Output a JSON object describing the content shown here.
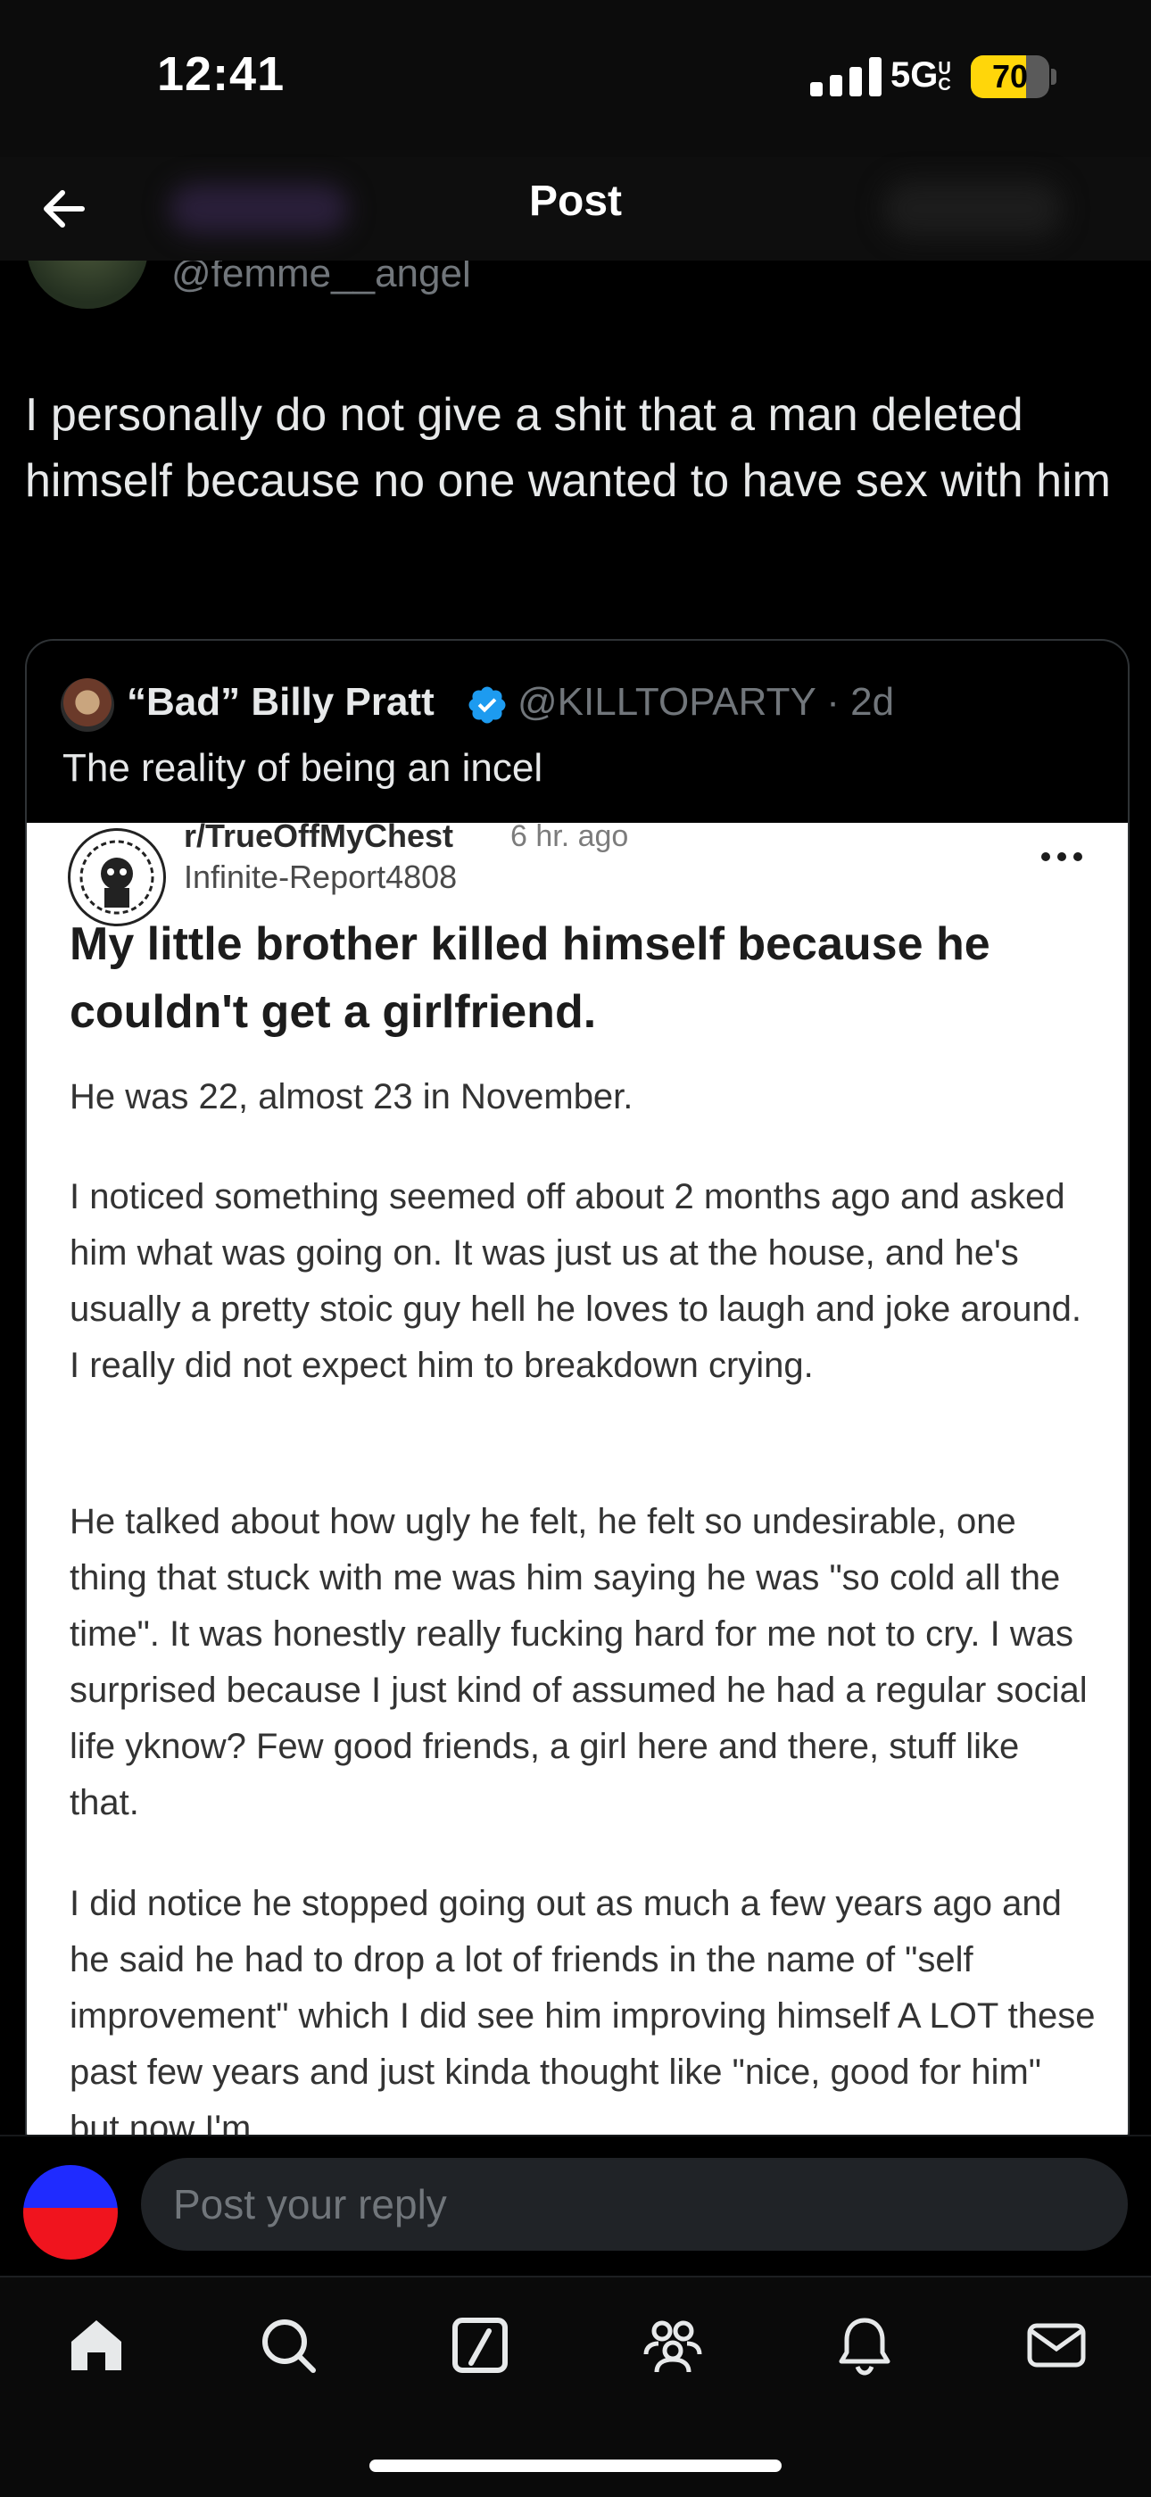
{
  "status_bar": {
    "time": "12:41",
    "network": "5G",
    "network_sup": "UC",
    "battery_percent": 70,
    "battery_label": "70"
  },
  "header": {
    "title": "Post"
  },
  "post": {
    "author_handle": "@femme__angel",
    "text": "I personally do not give a shit that a man deleted himself because no one wanted to have sex with him"
  },
  "quote": {
    "author_name": "“Bad” Billy Pratt",
    "handle": "@KILLTOPARTY",
    "age": "· 2d",
    "text": "The reality of being an incel",
    "reddit": {
      "subreddit": "r/TrueOffMyChest",
      "age": "6 hr. ago",
      "username": "Infinite-Report4808",
      "title": "My little brother killed himself because he couldn't get a girlfriend.",
      "paragraphs": [
        "He was 22, almost 23 in November.",
        "I noticed something seemed off about 2 months ago and asked him what was going on. It was just us at the house, and he's usually a pretty stoic guy hell he loves to laugh and joke around. I really did not expect him to breakdown crying.",
        "He talked about how ugly he felt, he felt so undesirable, one thing that stuck with me was him saying he was \"so cold all the time\". It was honestly really fucking hard for me not to cry. I was surprised because I just kind of assumed he had a regular social life yknow? Few good friends, a girl here and there, stuff like that.",
        "I did notice he stopped going out as much a few years ago and he said he had to drop a lot of friends in the name of \"self improvement\" which I did see him improving himself A LOT these past few years and just kinda thought like \"nice, good for him\" but now I'm"
      ]
    }
  },
  "composer": {
    "placeholder": "Post your reply"
  },
  "tab_bar": {
    "items": [
      "home-icon",
      "search-icon",
      "grok-icon",
      "communities-icon",
      "notifications-icon",
      "messages-icon"
    ]
  },
  "colors": {
    "verified": "#1d9bf0",
    "battery": "#ffd60a",
    "muted": "#71767b"
  }
}
